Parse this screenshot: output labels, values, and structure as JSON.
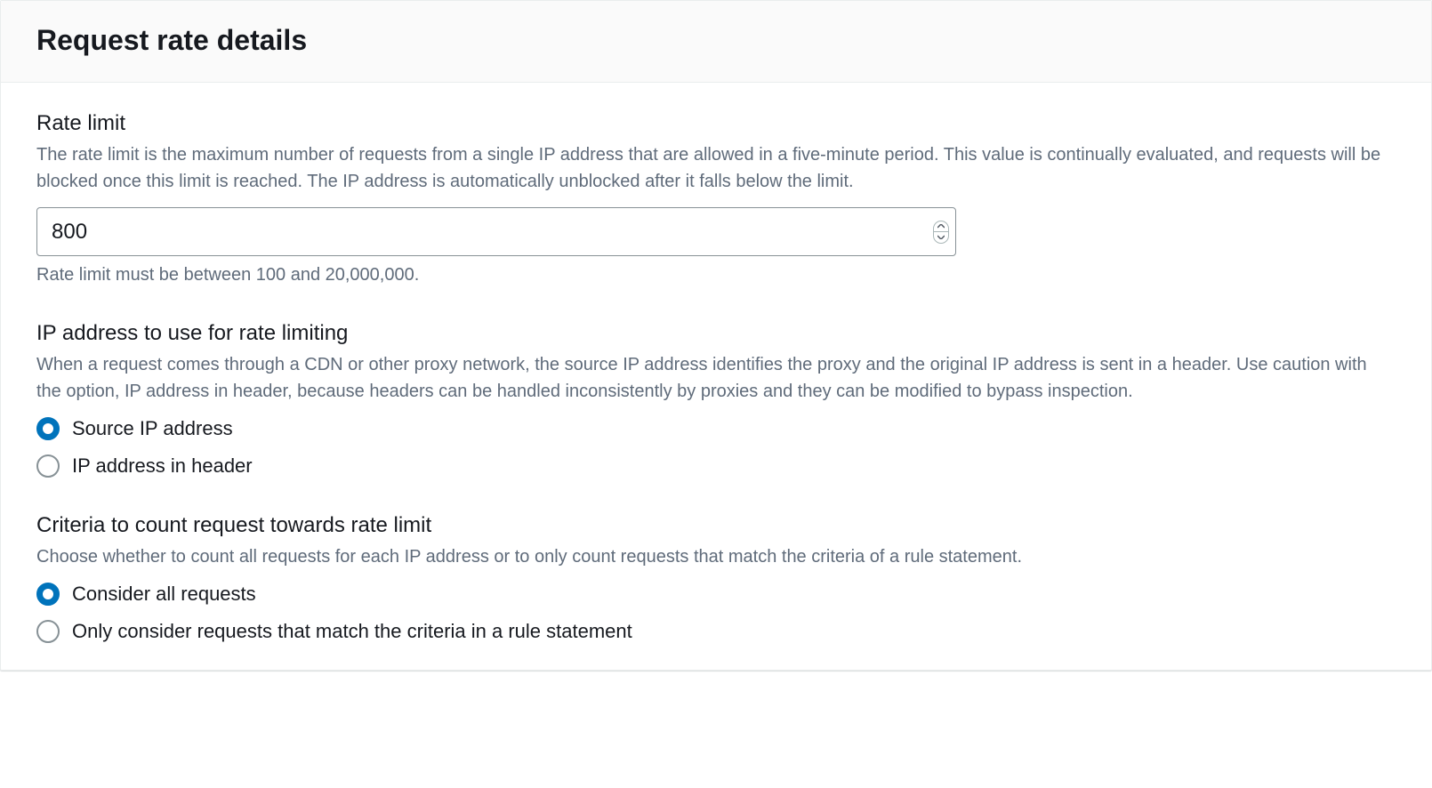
{
  "panel": {
    "title": "Request rate details"
  },
  "rateLimit": {
    "label": "Rate limit",
    "description": "The rate limit is the maximum number of requests from a single IP address that are allowed in a five-minute period. This value is continually evaluated, and requests will be blocked once this limit is reached. The IP address is automatically unblocked after it falls below the limit.",
    "value": "800",
    "hint": "Rate limit must be between 100 and 20,000,000."
  },
  "ipAddress": {
    "label": "IP address to use for rate limiting",
    "description": "When a request comes through a CDN or other proxy network, the source IP address identifies the proxy and the original IP address is sent in a header. Use caution with the option, IP address in header, because headers can be handled inconsistently by proxies and they can be modified to bypass inspection.",
    "options": {
      "sourceIp": "Source IP address",
      "headerIp": "IP address in header"
    }
  },
  "criteria": {
    "label": "Criteria to count request towards rate limit",
    "description": "Choose whether to count all requests for each IP address or to only count requests that match the criteria of a rule statement.",
    "options": {
      "allRequests": "Consider all requests",
      "ruleMatch": "Only consider requests that match the criteria in a rule statement"
    }
  }
}
